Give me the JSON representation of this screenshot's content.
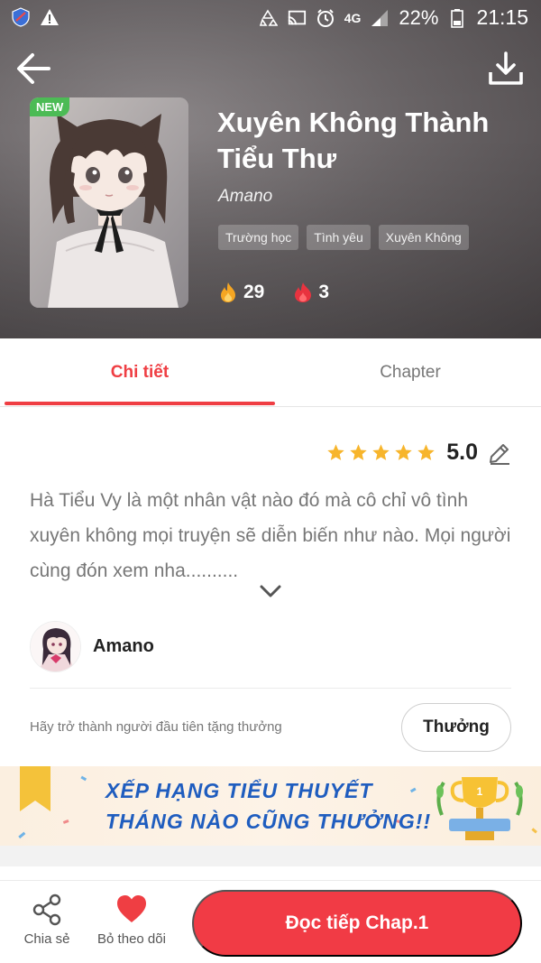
{
  "status_bar": {
    "network": "4G",
    "battery": "22%",
    "time": "21:15"
  },
  "header": {
    "back_icon": "arrow-left-icon",
    "download_icon": "download-icon"
  },
  "book": {
    "badge": "NEW",
    "title": "Xuyên Không Thành Tiểu Thư",
    "author": "Amano",
    "tags": [
      "Trường học",
      "Tình yêu",
      "Xuyên Không"
    ],
    "stats": {
      "fire_count": "29",
      "flame_count": "3"
    }
  },
  "tabs": [
    {
      "label": "Chi tiết",
      "active": true
    },
    {
      "label": "Chapter",
      "active": false
    }
  ],
  "rating": {
    "stars": 5,
    "value": "5.0"
  },
  "description": "Hà Tiểu Vy là một nhân vật nào đó mà cô chỉ vô tình xuyên không mọi truyện sẽ diễn biến như nào. Mọi người cùng đón xem nha..........",
  "author_row": {
    "name": "Amano"
  },
  "gift": {
    "text": "Hãy trở thành người đầu tiên tặng thưởng",
    "button": "Thưởng"
  },
  "banner": {
    "line1": "XẾP HẠNG TIỂU THUYẾT",
    "line2": "THÁNG NÀO CŨNG THƯỞNG!!"
  },
  "bottom_bar": {
    "share_label": "Chia sẻ",
    "follow_label": "Bỏ theo dõi",
    "read_button": "Đọc tiếp Chap.1"
  },
  "colors": {
    "accent": "#ef3e43",
    "new_badge": "#4cbb55",
    "star": "#f7b52c",
    "banner_text": "#1f5dbf"
  }
}
